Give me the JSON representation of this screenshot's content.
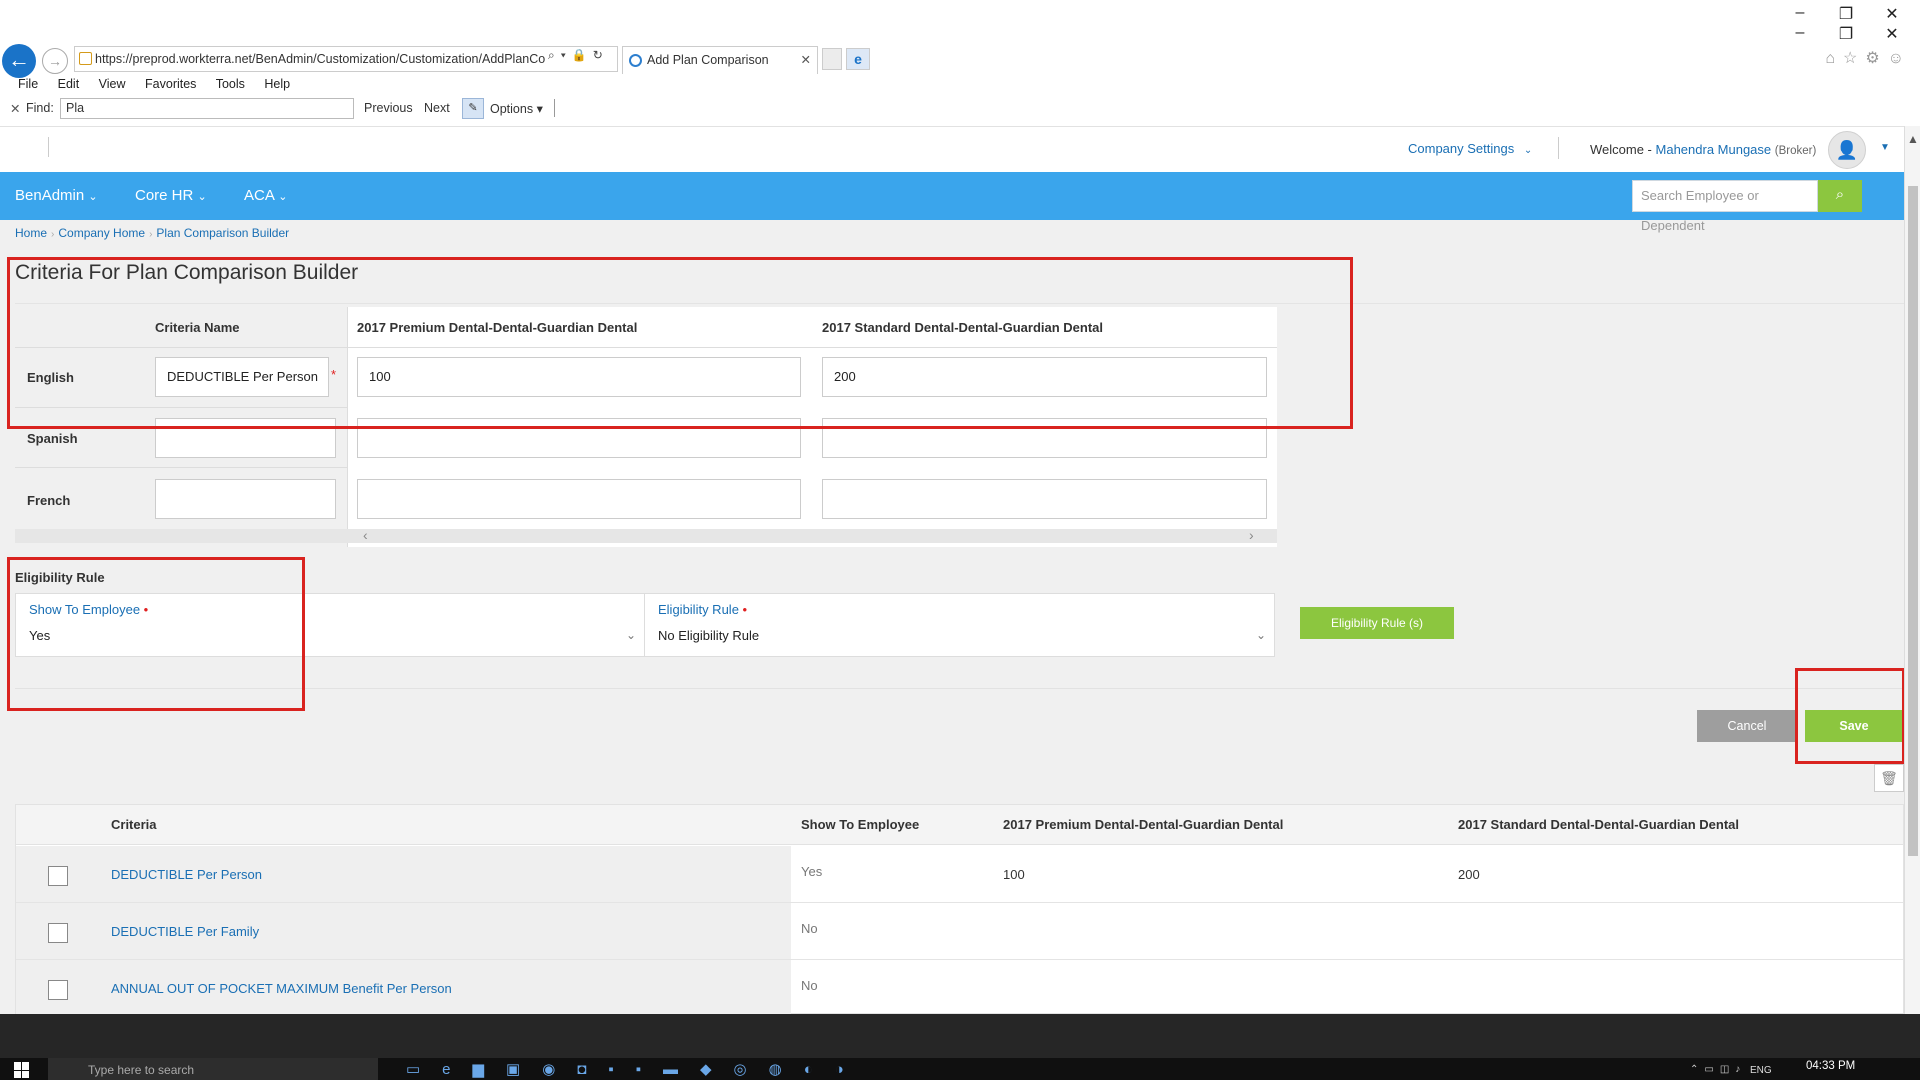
{
  "browser": {
    "url": "https://preprod.workterra.net/BenAdmin/Customization/Customization/AddPlanCo",
    "tab_title": "Add Plan Comparison",
    "menu": [
      "File",
      "Edit",
      "View",
      "Favorites",
      "Tools",
      "Help"
    ],
    "find": {
      "label": "Find:",
      "value": "Pla",
      "previous": "Previous",
      "next": "Next",
      "options": "Options"
    }
  },
  "header": {
    "company_settings": "Company Settings",
    "welcome": "Welcome -",
    "user_name": "Mahendra Mungase",
    "user_role": "(Broker)"
  },
  "nav": {
    "items": [
      "BenAdmin",
      "Core HR",
      "ACA"
    ],
    "search_placeholder": "Search Employee or Dependent"
  },
  "breadcrumb": [
    "Home",
    "Company Home",
    "Plan Comparison Builder"
  ],
  "page_title": "Criteria For Plan Comparison Builder",
  "criteria_grid": {
    "headers": [
      "Criteria Name",
      "2017 Premium Dental-Dental-Guardian Dental",
      "2017 Standard Dental-Dental-Guardian Dental"
    ],
    "rows": [
      {
        "language": "English",
        "criteria_name": "DEDUCTIBLE  Per Person",
        "premium": "100",
        "standard": "200"
      },
      {
        "language": "Spanish",
        "criteria_name": "",
        "premium": "",
        "standard": ""
      },
      {
        "language": "French",
        "criteria_name": "",
        "premium": "",
        "standard": ""
      }
    ]
  },
  "eligibility": {
    "title": "Eligibility Rule",
    "show_to_employee_label": "Show To Employee",
    "show_to_employee_value": "Yes",
    "eligibility_rule_label": "Eligibility Rule",
    "eligibility_rule_value": "No Eligibility Rule",
    "rules_button": "Eligibility Rule (s)"
  },
  "actions": {
    "cancel": "Cancel",
    "save": "Save"
  },
  "table": {
    "headers": [
      "Criteria",
      "Show To Employee",
      "2017 Premium Dental-Dental-Guardian Dental",
      "2017 Standard Dental-Dental-Guardian Dental"
    ],
    "rows": [
      {
        "criteria": "DEDUCTIBLE Per Person",
        "show": "Yes",
        "premium": "100",
        "standard": "200"
      },
      {
        "criteria": "DEDUCTIBLE Per Family",
        "show": "No",
        "premium": "",
        "standard": ""
      },
      {
        "criteria": "ANNUAL OUT OF POCKET MAXIMUM Benefit Per Person",
        "show": "No",
        "premium": "",
        "standard": ""
      }
    ]
  },
  "taskbar": {
    "search_placeholder": "Type here to search",
    "language": "ENG",
    "time": "04:33 PM"
  },
  "colors": {
    "nav_blue": "#3aa5ec",
    "link_blue": "#1a6fb4",
    "green": "#8cc63f",
    "annotation_red": "#d9231f"
  }
}
